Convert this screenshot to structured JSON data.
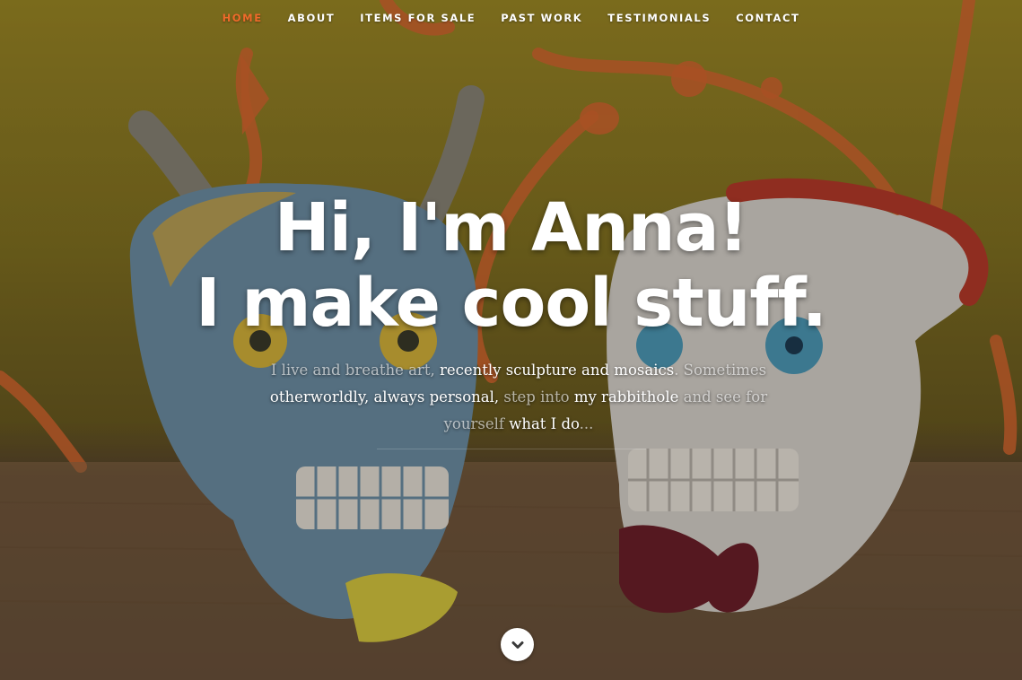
{
  "nav": {
    "items": [
      {
        "label": "HOME",
        "active": true
      },
      {
        "label": "ABOUT",
        "active": false
      },
      {
        "label": "ITEMS FOR SALE",
        "active": false
      },
      {
        "label": "PAST WORK",
        "active": false
      },
      {
        "label": "TESTIMONIALS",
        "active": false
      },
      {
        "label": "CONTACT",
        "active": false
      }
    ],
    "active_color": "#ef6a2a"
  },
  "hero": {
    "headline_line1": "Hi, I'm Anna!",
    "headline_line2": "I make cool stuff.",
    "tagline": {
      "p1": "I live and breathe art, ",
      "p2": "recently sculpture and mosaics",
      "p3": ". Sometimes ",
      "p4": "otherworldly",
      "p5": ", always personal, ",
      "p6": "step into ",
      "p7": "my rabbithole",
      "p8": " and see for yourself ",
      "p9": "what I do",
      "p10": "..."
    },
    "scroll_icon": "chevron-down-icon"
  },
  "colors": {
    "accent": "#ef6a2a",
    "wall": "#b9a12c",
    "table": "#7a5e3e"
  }
}
